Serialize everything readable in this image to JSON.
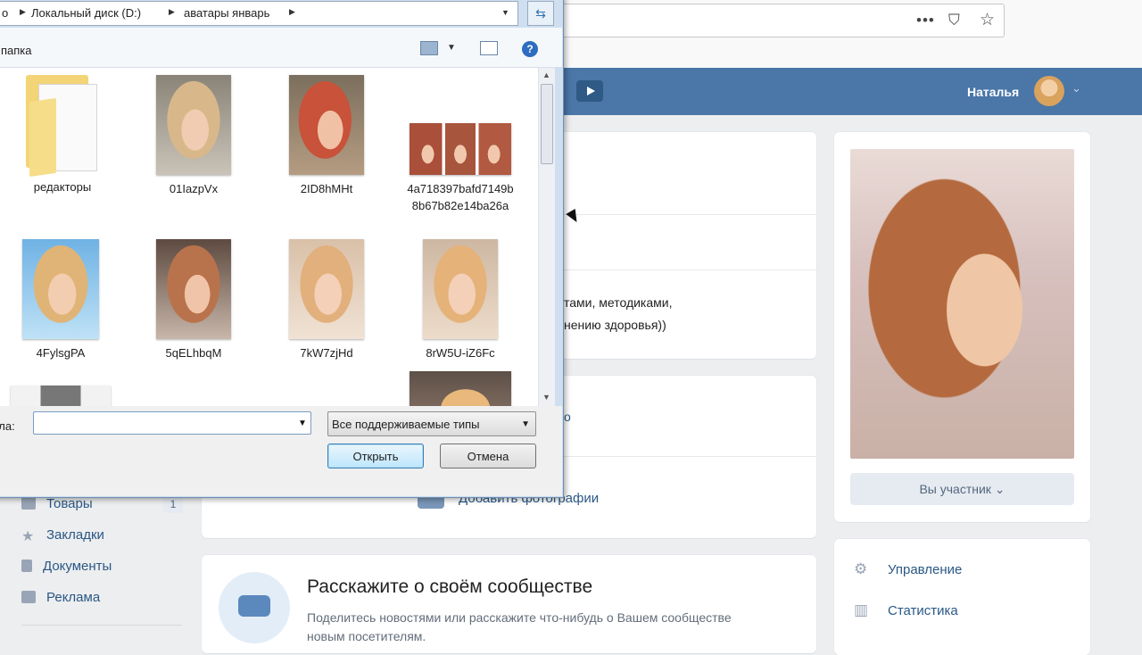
{
  "browser": {
    "url_icons": [
      "more-icon",
      "pocket-icon",
      "star-icon"
    ],
    "menu_glyph": "•••",
    "star_glyph": "☆",
    "pocket_glyph": "⛉"
  },
  "vk_header": {
    "user_name": "Наталья",
    "caret": "⌄",
    "accent_color": "#4a76a8"
  },
  "info_card": {
    "line1": "тами, методиками,",
    "line2": "нению здоровья))",
    "partial_link": "о",
    "add_photo_label": "Добавить фотографии"
  },
  "left_menu": [
    {
      "label": "Товары",
      "icon": "shop-icon",
      "count": "1"
    },
    {
      "label": "Закладки",
      "icon": "star-icon"
    },
    {
      "label": "Документы",
      "icon": "document-icon"
    },
    {
      "label": "Реклама",
      "icon": "megaphone-icon"
    }
  ],
  "community": {
    "title": "Расскажите о своём сообществе",
    "description": "Поделитесь новостями или расскажите что-нибудь о Вашем сообществе новым посетителям."
  },
  "sidebar_right": {
    "member_button": "Вы участник ⌄",
    "items": [
      {
        "label": "Управление",
        "icon": "gear-icon",
        "glyph": "⚙"
      },
      {
        "label": "Статистика",
        "icon": "bar-chart-icon",
        "glyph": "▥"
      }
    ]
  },
  "dialog": {
    "breadcrumb": [
      "о",
      "Локальный диск (D:)",
      "аватары январь"
    ],
    "new_folder_label": "папка",
    "help_glyph": "?",
    "refresh_glyph": "⇆",
    "files": [
      {
        "name": "редакторы",
        "kind": "folder"
      },
      {
        "name": "01IazpVx",
        "kind": "image"
      },
      {
        "name": "2ID8hMHt",
        "kind": "image"
      },
      {
        "name": "4a718397bafd7149b8b67b82e14ba26a",
        "kind": "image"
      },
      {
        "name": "4FylsgPA",
        "kind": "image"
      },
      {
        "name": "5qELhbqM",
        "kind": "image"
      },
      {
        "name": "7kW7zjHd",
        "kind": "image"
      },
      {
        "name": "8rW5U-iZ6Fc",
        "kind": "image"
      }
    ],
    "filename_label": "йла:",
    "filename_value": "",
    "file_type": "Все поддерживаемые типы",
    "open_button": "Открыть",
    "cancel_button": "Отмена"
  }
}
